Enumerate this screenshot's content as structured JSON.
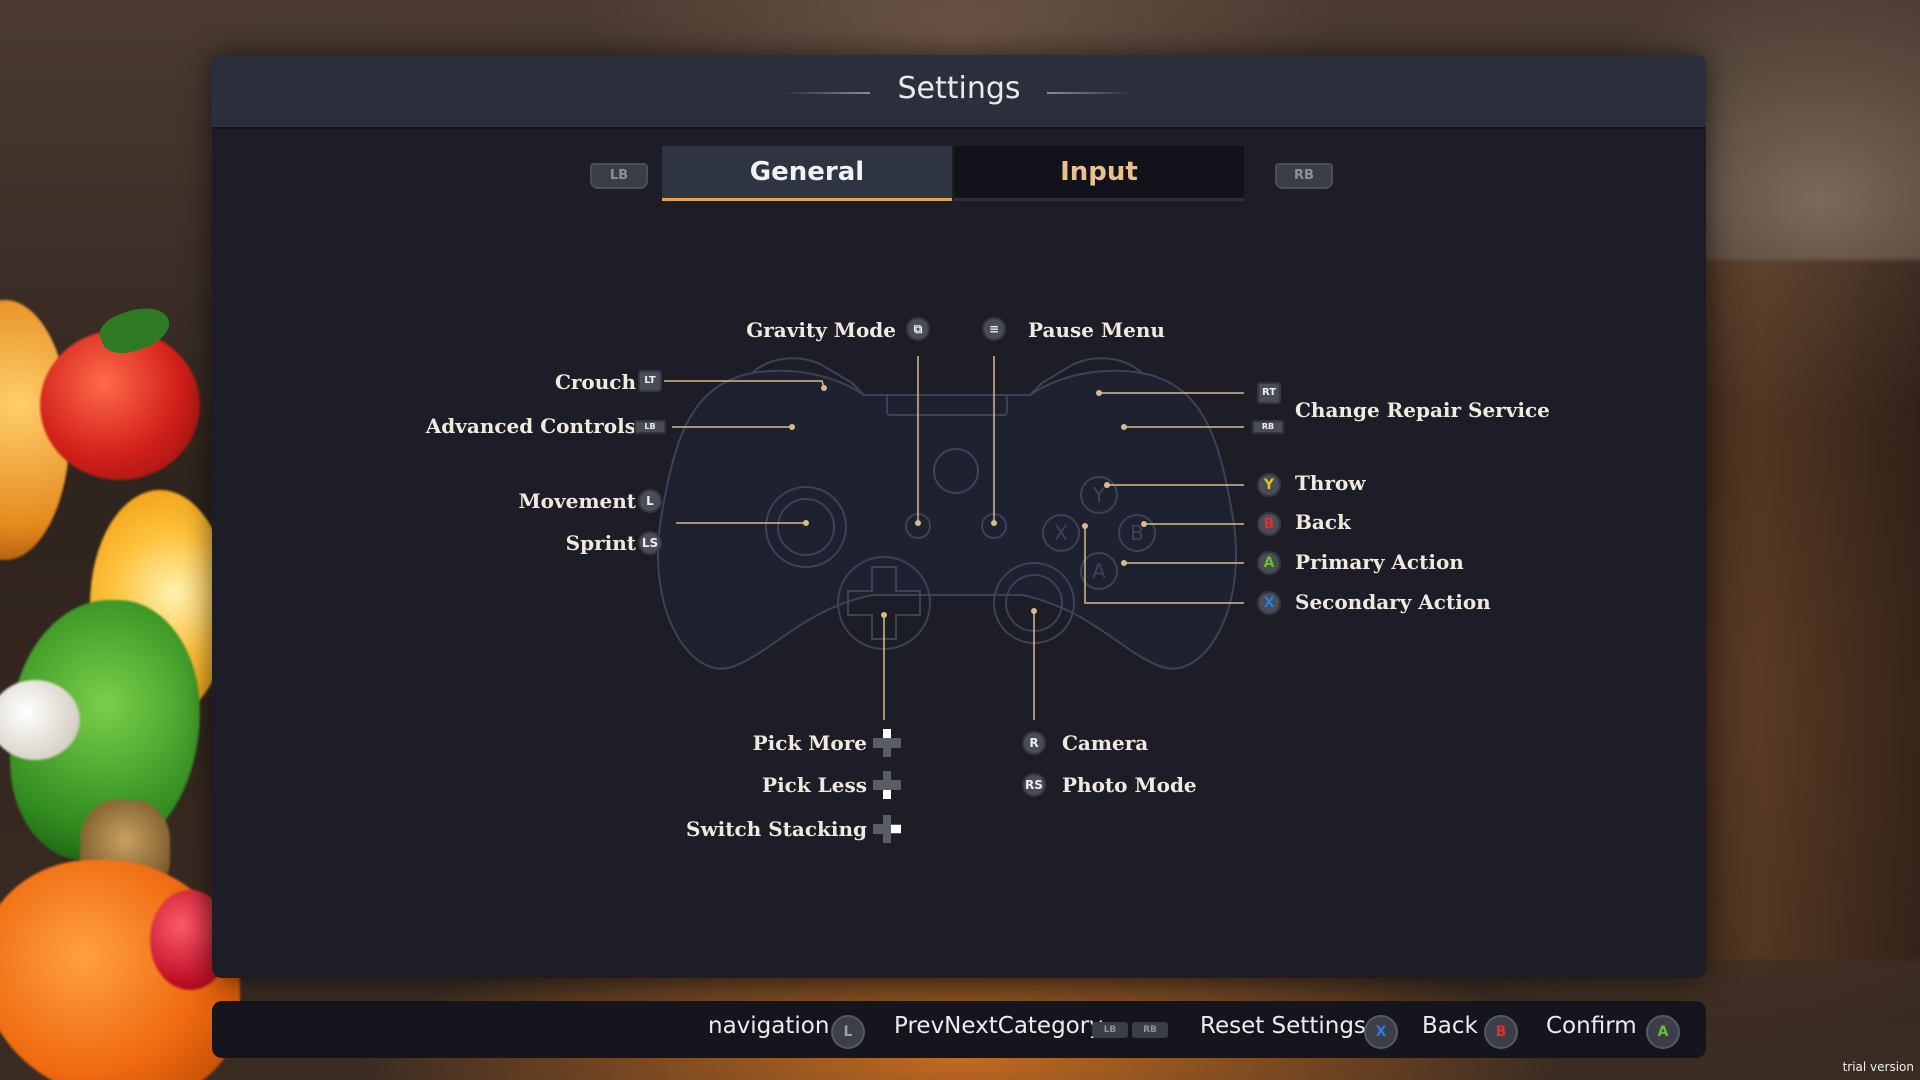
{
  "window": {
    "title": "Settings"
  },
  "tabs": {
    "left_shoulder": "LB",
    "right_shoulder": "RB",
    "general": "General",
    "input": "Input",
    "active": "General"
  },
  "controls": {
    "gravity_mode": {
      "label": "Gravity Mode",
      "icon": "view-button-icon"
    },
    "pause_menu": {
      "label": "Pause Menu",
      "icon": "menu-button-icon"
    },
    "crouch": {
      "label": "Crouch",
      "button": "LT"
    },
    "advanced_controls": {
      "label": "Advanced Controls",
      "button": "LB"
    },
    "movement": {
      "label": "Movement",
      "button": "L"
    },
    "sprint": {
      "label": "Sprint",
      "button": "LS"
    },
    "change_repair_service": {
      "label": "Change Repair Service",
      "buttons": [
        "RT",
        "RB"
      ]
    },
    "throw": {
      "label": "Throw",
      "button": "Y"
    },
    "back": {
      "label": "Back",
      "button": "B"
    },
    "primary_action": {
      "label": "Primary Action",
      "button": "A"
    },
    "secondary_action": {
      "label": "Secondary Action",
      "button": "X"
    },
    "pick_more": {
      "label": "Pick More",
      "icon": "dpad-up-icon"
    },
    "pick_less": {
      "label": "Pick Less",
      "icon": "dpad-down-icon"
    },
    "switch_stacking": {
      "label": "Switch Stacking",
      "icon": "dpad-right-icon"
    },
    "camera": {
      "label": "Camera",
      "button": "R"
    },
    "photo_mode": {
      "label": "Photo Mode",
      "button": "RS"
    }
  },
  "footer": {
    "navigation": {
      "label": "navigation",
      "button": "L"
    },
    "prev_next": {
      "label": "PrevNextCategory",
      "buttons": [
        "LB",
        "RB"
      ]
    },
    "reset": {
      "label": "Reset Settings",
      "button": "X"
    },
    "back": {
      "label": "Back",
      "button": "B"
    },
    "confirm": {
      "label": "Confirm",
      "button": "A"
    }
  },
  "watermark": "trial version",
  "colors": {
    "accent": "#e3a14c",
    "button_y": "#e8c21a",
    "button_b": "#e0302a",
    "button_a": "#6ac02a",
    "button_x": "#2a7ee0",
    "panel": "#1c1d27",
    "label": "#f1e9dd"
  }
}
